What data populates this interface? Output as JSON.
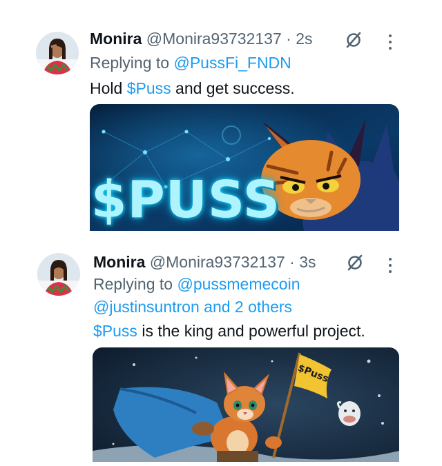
{
  "tweets": [
    {
      "author_name": "Monira",
      "author_handle": "@Monira93732137",
      "separator": "·",
      "time": "2s",
      "replying_prefix": "Replying to",
      "replying_to": [
        "@PussFi_FNDN"
      ],
      "replying_others": "",
      "body_parts": [
        {
          "text": "Hold ",
          "type": "text"
        },
        {
          "text": "$Puss",
          "type": "cashtag"
        },
        {
          "text": " and get success.",
          "type": "text"
        }
      ],
      "media": {
        "banner_text": "$PUSS"
      }
    },
    {
      "author_name": "Monira",
      "author_handle": "@Monira93732137",
      "separator": "·",
      "time": "3s",
      "replying_prefix": "Replying to",
      "replying_to": [
        "@pussmemecoin",
        "@justinsuntron"
      ],
      "replying_and": "and",
      "replying_others": "2 others",
      "body_parts": [
        {
          "text": "$Puss",
          "type": "cashtag"
        },
        {
          "text": " is the king and powerful project.",
          "type": "text"
        }
      ],
      "media": {
        "flag_text": "$Puss"
      }
    }
  ],
  "icons": {
    "grok": "slashed-circle-icon",
    "more": "more-vertical-icon"
  },
  "colors": {
    "link": "#1d9bf0",
    "muted": "#536471",
    "text": "#0f1419"
  }
}
